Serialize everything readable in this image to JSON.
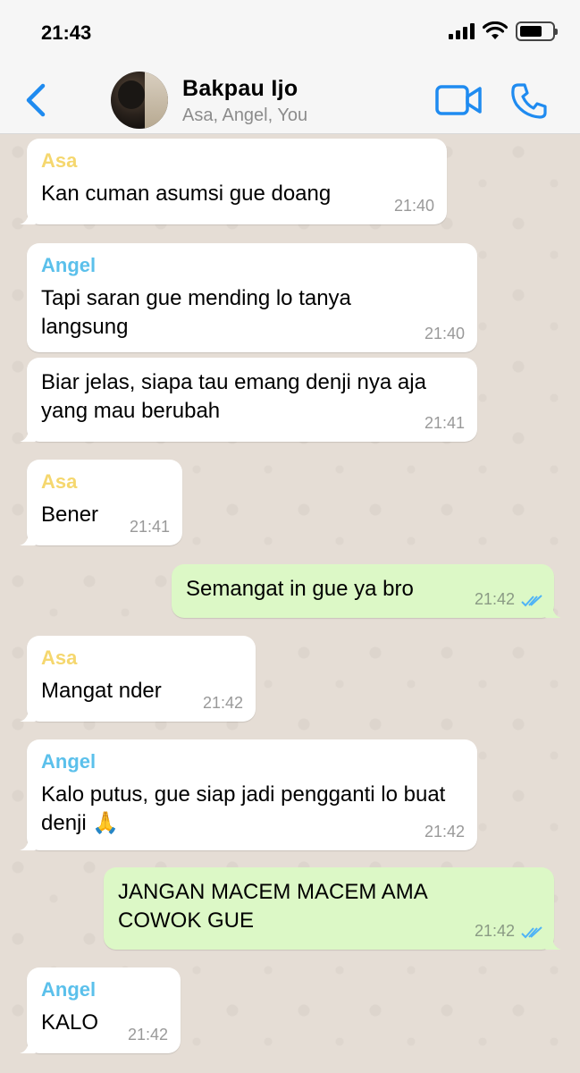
{
  "status_bar": {
    "time": "21:43"
  },
  "header": {
    "title": "Bakpau Ijo",
    "members": "Asa, Angel, You"
  },
  "colors": {
    "asa": "#f5d76e",
    "angel": "#5bc0eb",
    "accent": "#1f8bf0",
    "outgoing_bubble": "#dcf8c6",
    "read_ticks": "#4fb3f6"
  },
  "messages": [
    {
      "sender": "Asa",
      "text": "Kan cuman asumsi gue doang",
      "time": "21:40"
    },
    {
      "sender": "Angel",
      "text": "Tapi saran gue mending lo tanya langsung",
      "time": "21:40"
    },
    {
      "sender": "",
      "text": "Biar jelas, siapa tau emang denji nya aja yang mau berubah",
      "time": "21:41"
    },
    {
      "sender": "Asa",
      "text": "Bener",
      "time": "21:41"
    },
    {
      "sender": "",
      "text": "Semangat in gue ya bro",
      "time": "21:42"
    },
    {
      "sender": "Asa",
      "text": "Mangat nder",
      "time": "21:42"
    },
    {
      "sender": "Angel",
      "text": "Kalo putus, gue siap jadi pengganti lo buat denji 🙏",
      "time": "21:42"
    },
    {
      "sender": "",
      "text": "JANGAN MACEM MACEM AMA COWOK GUE",
      "time": "21:42"
    },
    {
      "sender": "Angel",
      "text": "KALO",
      "time": "21:42"
    }
  ]
}
